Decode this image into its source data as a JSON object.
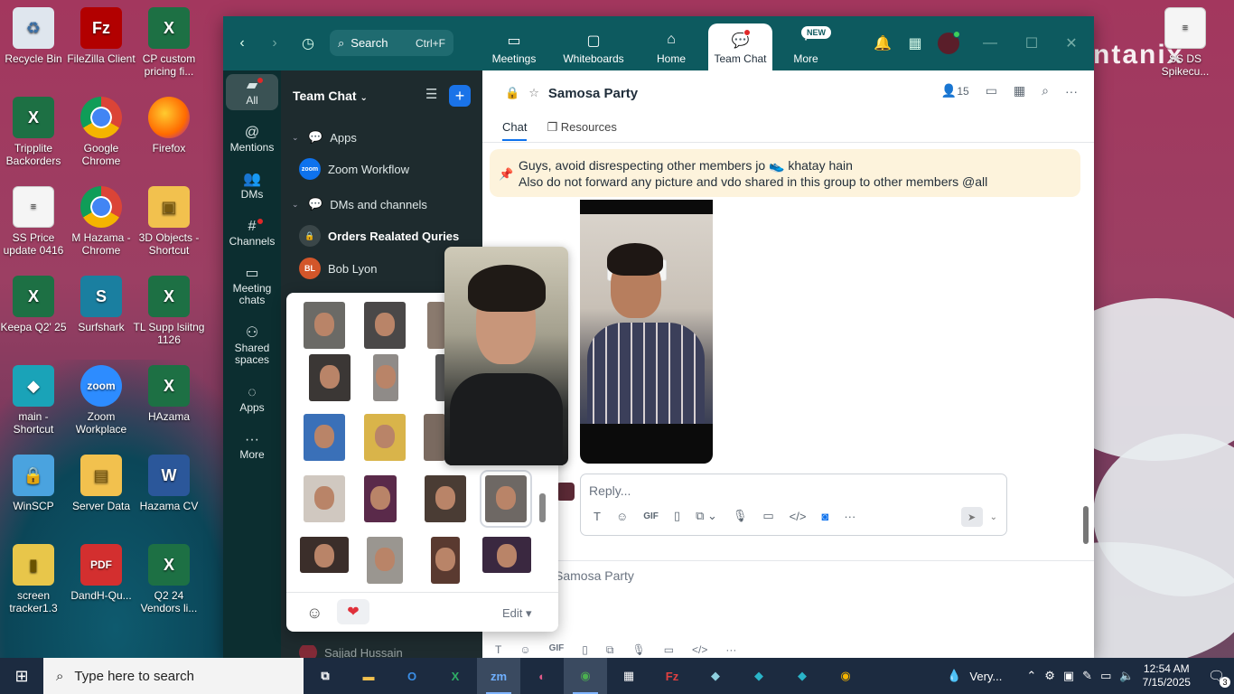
{
  "desktop": {
    "icons_col1": [
      {
        "label": "Recycle Bin",
        "icon": "recycle-bin-icon"
      },
      {
        "label": "Tripplite Backorders",
        "icon": "excel-icon"
      },
      {
        "label": "SS Price update 0416",
        "icon": "document-icon"
      },
      {
        "label": "Keepa Q2' 25",
        "icon": "excel-icon"
      },
      {
        "label": "main - Shortcut",
        "icon": "app-icon"
      },
      {
        "label": "WinSCP",
        "icon": "winscp-icon"
      },
      {
        "label": "screen tracker1.3",
        "icon": "zip-icon"
      }
    ],
    "icons_col2": [
      {
        "label": "FileZilla Client",
        "icon": "filezilla-icon"
      },
      {
        "label": "Google Chrome",
        "icon": "chrome-icon"
      },
      {
        "label": "M Hazama - Chrome",
        "icon": "chrome-icon"
      },
      {
        "label": "Surfshark",
        "icon": "surfshark-icon"
      },
      {
        "label": "Zoom Workplace",
        "icon": "zoom-icon"
      },
      {
        "label": "Server Data",
        "icon": "folder-icon"
      },
      {
        "label": "DandH-Qu...",
        "icon": "pdf-icon"
      }
    ],
    "icons_col3": [
      {
        "label": "CP custom pricing fi...",
        "icon": "excel-icon"
      },
      {
        "label": "Firefox",
        "icon": "firefox-icon"
      },
      {
        "label": "3D Objects - Shortcut",
        "icon": "folder-icon"
      },
      {
        "label": "TL Supp lsiitng 1126",
        "icon": "excel-icon"
      },
      {
        "label": "HAzama",
        "icon": "excel-icon"
      },
      {
        "label": "Hazama CV",
        "icon": "word-icon"
      },
      {
        "label": "Q2 24 Vendors li...",
        "icon": "excel-icon"
      }
    ],
    "right_icon": {
      "label": "SS DS Spikecu..."
    },
    "brand_text": "ntanix"
  },
  "zoom": {
    "search": {
      "label": "Search",
      "shortcut": "Ctrl+F"
    },
    "nav_tabs": [
      {
        "label": "Meetings",
        "icon": "video-icon"
      },
      {
        "label": "Whiteboards",
        "icon": "whiteboard-icon"
      },
      {
        "label": "Home",
        "icon": "home-icon"
      },
      {
        "label": "Team Chat",
        "icon": "chat-icon",
        "active": true
      },
      {
        "label": "More",
        "icon": "more-icon"
      }
    ],
    "new_badge": "NEW",
    "rail": [
      {
        "label": "All",
        "icon": "chat-bubble-icon"
      },
      {
        "label": "Mentions",
        "icon": "at-icon"
      },
      {
        "label": "DMs",
        "icon": "people-icon"
      },
      {
        "label": "Channels",
        "icon": "hash-icon"
      },
      {
        "label": "Meeting chats",
        "icon": "calendar-icon"
      },
      {
        "label": "Shared spaces",
        "icon": "share-icon"
      },
      {
        "label": "Apps",
        "icon": "apps-icon"
      },
      {
        "label": "More",
        "icon": "dots-icon"
      }
    ],
    "panel": {
      "title": "Team Chat",
      "sections": {
        "apps": "Apps",
        "zoom_workflow": "Zoom Workflow",
        "dms_channels": "DMs and channels",
        "orders": "Orders Realated Quries",
        "bob": "Bob Lyon",
        "bob_initials": "BL",
        "sajjad": "Sajjad Hussain"
      }
    },
    "chat": {
      "title": "Samosa Party",
      "member_count": "15",
      "tabs": {
        "chat": "Chat",
        "resources": "Resources"
      },
      "pinned_line1": "Guys, avoid disrespecting other members jo 👟 khatay hain",
      "pinned_line2": "Also do not forward any picture and vdo shared in this group to other members @all",
      "reply_placeholder": "Reply...",
      "gif": "GIF",
      "second_title": "Samosa Party"
    },
    "stickers": {
      "edit_label": "Edit"
    }
  },
  "taskbar": {
    "search_placeholder": "Type here to search",
    "weather": "Very...",
    "time": "12:54 AM",
    "date": "7/15/2025",
    "notifications": "3"
  }
}
